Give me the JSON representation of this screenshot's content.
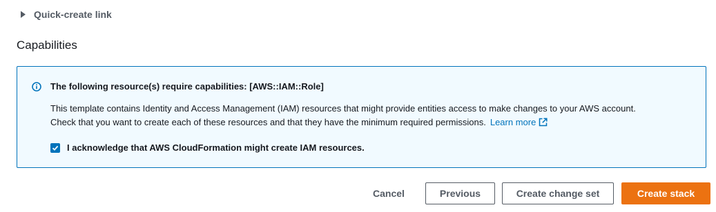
{
  "quick_create": {
    "label": "Quick-create link",
    "expanded": false
  },
  "capabilities": {
    "heading": "Capabilities",
    "alert": {
      "icon": "info-icon",
      "accent_color": "#0073bb",
      "title": "The following resource(s) require capabilities: [AWS::IAM::Role]",
      "body_line_1": "This template contains Identity and Access Management (IAM) resources that might provide entities access to make changes to your AWS account.",
      "body_line_2": "Check that you want to create each of these resources and that they have the minimum required permissions.",
      "learn_more": "Learn more",
      "learn_more_icon": "external-link-icon"
    },
    "acknowledge": {
      "label": "I acknowledge that AWS CloudFormation might create IAM resources.",
      "checked": true
    }
  },
  "footer": {
    "cancel_label": "Cancel",
    "previous_label": "Previous",
    "create_change_set_label": "Create change set",
    "create_stack_label": "Create stack",
    "primary_color": "#ec7211"
  }
}
